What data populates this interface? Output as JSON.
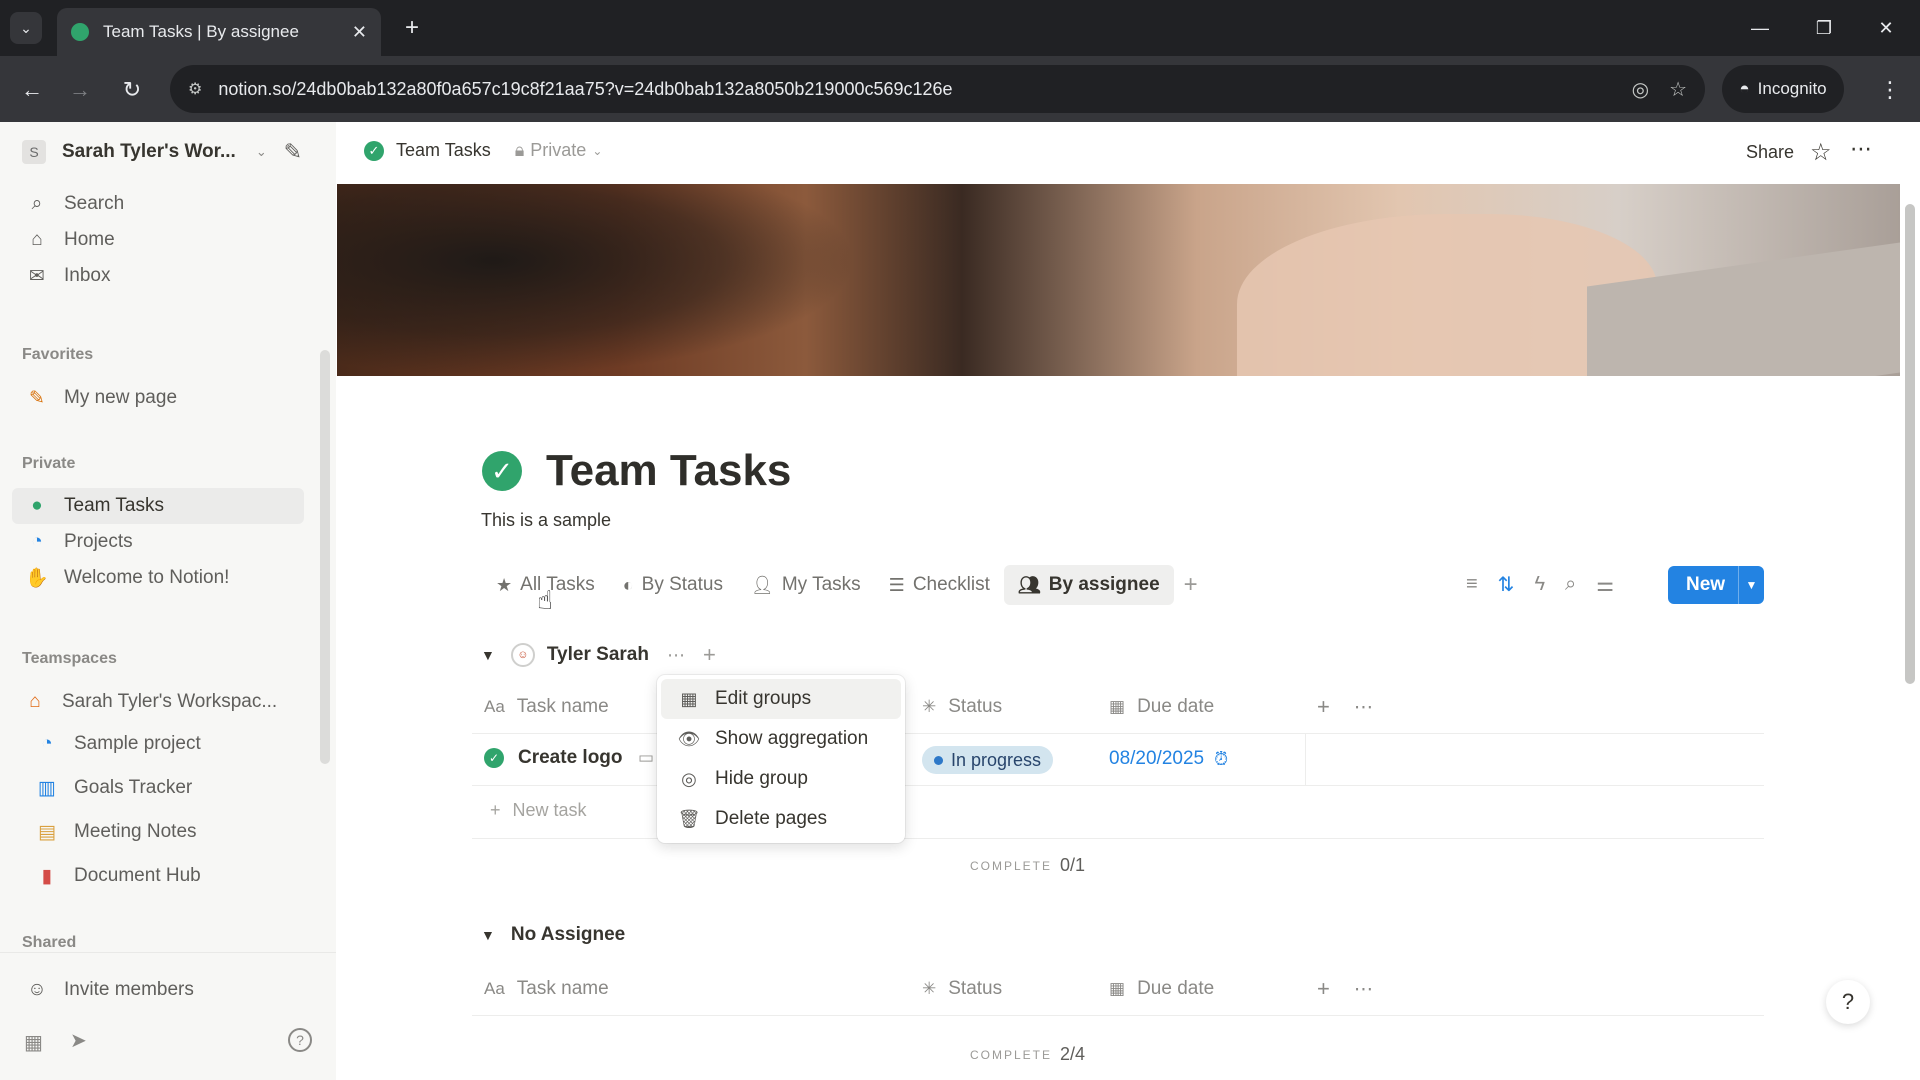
{
  "browser": {
    "tab_title": "Team Tasks | By assignee",
    "url": "notion.so/24db0bab132a80f0a657c19c8f21aa75?v=24db0bab132a8050b219000c569c126e",
    "incognito_label": "Incognito"
  },
  "sidebar": {
    "workspace_name": "Sarah Tyler's Wor...",
    "workspace_initial": "S",
    "top_items": [
      {
        "label": "Search",
        "icon": "search-icon"
      },
      {
        "label": "Home",
        "icon": "home-icon"
      },
      {
        "label": "Inbox",
        "icon": "inbox-icon"
      }
    ],
    "favorites_label": "Favorites",
    "favorites": [
      {
        "label": "My new page",
        "icon": "pencil-icon"
      }
    ],
    "private_label": "Private",
    "private_items": [
      {
        "label": "Team Tasks",
        "icon": "check-circle-icon"
      },
      {
        "label": "Projects",
        "icon": "projects-icon"
      },
      {
        "label": "Welcome to Notion!",
        "icon": "wave-icon"
      }
    ],
    "teamspaces_label": "Teamspaces",
    "teamspaces": [
      {
        "label": "Sarah Tyler's Workspac...",
        "icon": "home-orange-icon"
      },
      {
        "label": "Sample project",
        "icon": "projects-icon"
      },
      {
        "label": "Goals Tracker",
        "icon": "chart-icon"
      },
      {
        "label": "Meeting Notes",
        "icon": "calendar-icon"
      },
      {
        "label": "Document Hub",
        "icon": "document-icon"
      }
    ],
    "shared_label": "Shared",
    "invite_label": "Invite members"
  },
  "topbar": {
    "crumb_title": "Team Tasks",
    "privacy": "Private",
    "share_label": "Share"
  },
  "page": {
    "title": "Team Tasks",
    "description": "This is a sample"
  },
  "views": [
    {
      "label": "All Tasks",
      "icon": "star-icon"
    },
    {
      "label": "By Status",
      "icon": "status-icon"
    },
    {
      "label": "My Tasks",
      "icon": "person-icon"
    },
    {
      "label": "Checklist",
      "icon": "checklist-icon"
    },
    {
      "label": "By assignee",
      "icon": "people-icon"
    }
  ],
  "new_button": "New",
  "columns": {
    "name": "Task name",
    "status": "Status",
    "due": "Due date"
  },
  "groups": [
    {
      "name": "Tyler Sarah",
      "rows": [
        {
          "task": "Create logo",
          "status": "In progress",
          "due": "08/20/2025"
        }
      ],
      "new_task": "New task",
      "complete_label": "COMPLETE",
      "complete_value": "0/1"
    },
    {
      "name": "No Assignee",
      "complete_label": "COMPLETE",
      "complete_value": "2/4"
    }
  ],
  "menu": {
    "items": [
      {
        "label": "Edit groups",
        "icon": "grid-icon"
      },
      {
        "label": "Show aggregation",
        "icon": "eye-icon"
      },
      {
        "label": "Hide group",
        "icon": "eye-off-icon"
      },
      {
        "label": "Delete pages",
        "icon": "trash-icon"
      }
    ]
  },
  "colors": {
    "accent": "#2383e2",
    "success": "#30a46c",
    "status_bg": "#d3e5ef"
  }
}
